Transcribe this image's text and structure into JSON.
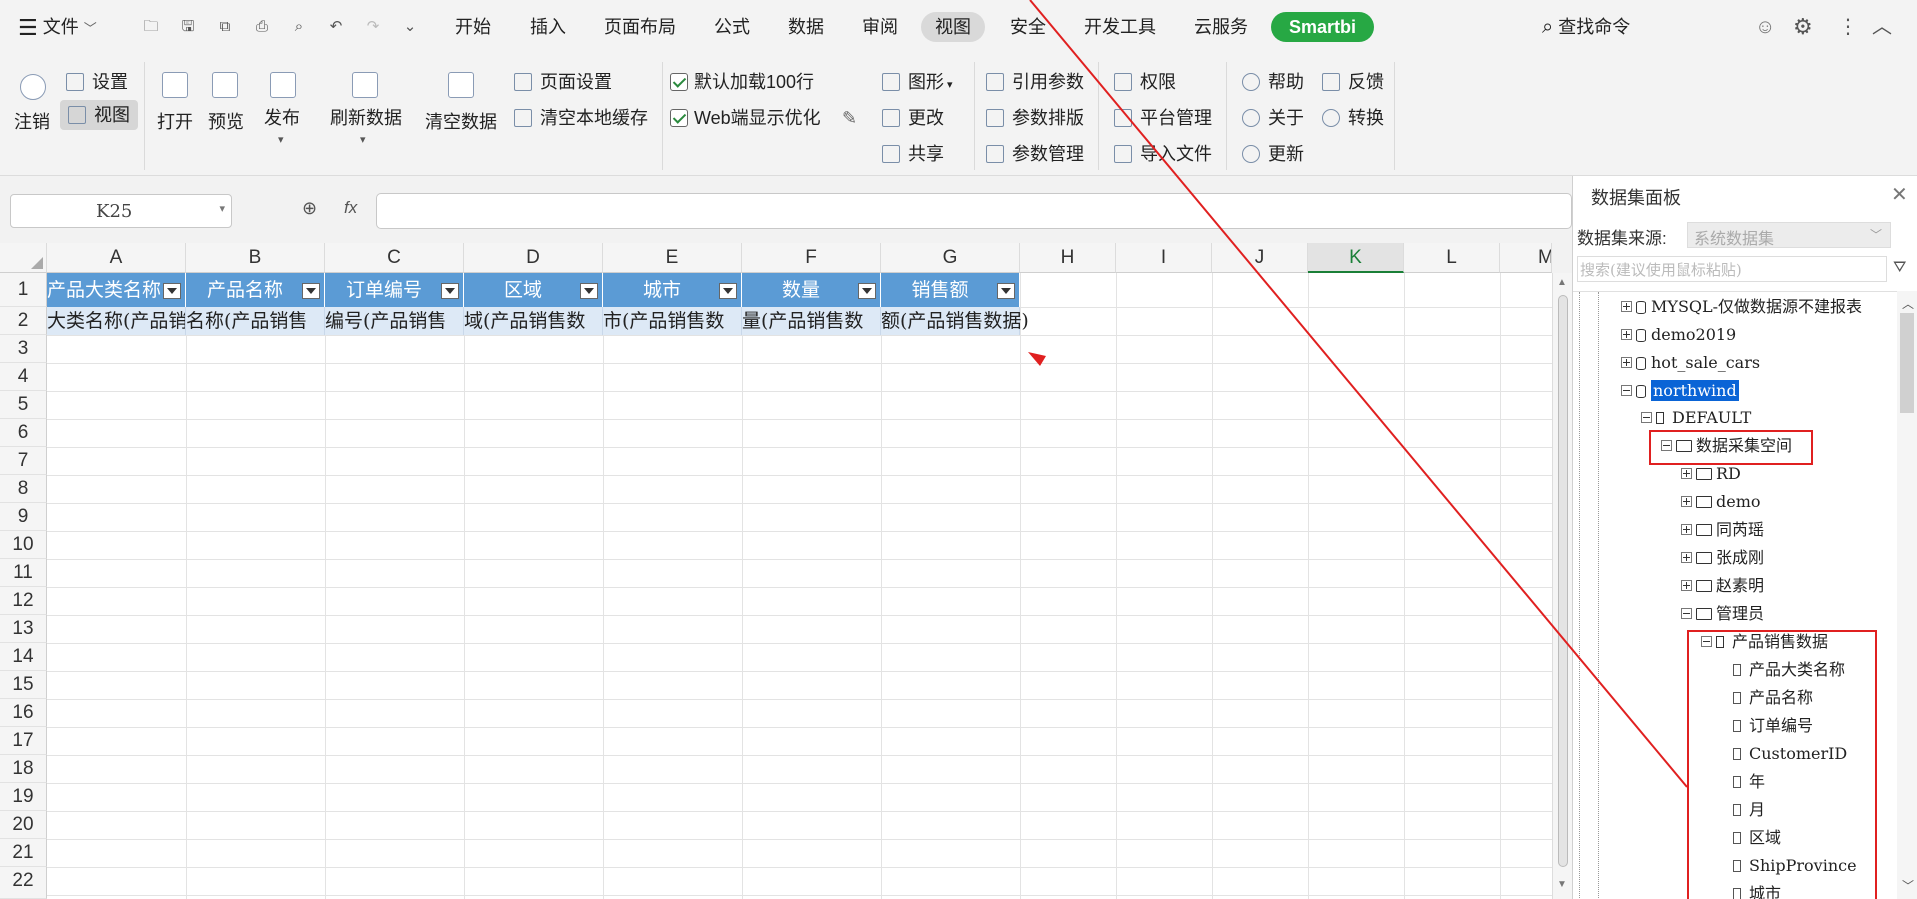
{
  "menubar": {
    "file_label": "文件",
    "tabs": [
      "开始",
      "插入",
      "页面布局",
      "公式",
      "数据",
      "审阅",
      "视图",
      "安全",
      "开发工具",
      "云服务"
    ],
    "smartbi_label": "Smartbi",
    "search_label": "查找命令"
  },
  "ribbon": {
    "logout": "注销",
    "settings": "设置",
    "view": "视图",
    "open": "打开",
    "preview": "预览",
    "publish": "发布",
    "refresh": "刷新数据",
    "clear_data": "清空数据",
    "page_setup": "页面设置",
    "clear_cache": "清空本地缓存",
    "default_load": "默认加载100行",
    "web_optimize": "Web端显示优化",
    "chart": "图形",
    "modify": "更改",
    "share": "共享",
    "ref_param": "引用参数",
    "param_layout": "参数排版",
    "param_manage": "参数管理",
    "permission": "权限",
    "platform": "平台管理",
    "import": "导入文件",
    "help": "帮助",
    "about": "关于",
    "update": "更新",
    "feedback": "反馈",
    "convert": "转换"
  },
  "formula_bar": {
    "cell_ref": "K25",
    "fx": "fx",
    "value": ""
  },
  "sheet": {
    "columns": [
      "A",
      "B",
      "C",
      "D",
      "E",
      "F",
      "G",
      "H",
      "I",
      "J",
      "K",
      "L",
      "M"
    ],
    "active_column": "K",
    "rows": [
      "1",
      "2",
      "3",
      "4",
      "5",
      "6",
      "7",
      "8",
      "9",
      "10",
      "11",
      "12",
      "13",
      "14",
      "15",
      "16",
      "17",
      "18",
      "19",
      "20",
      "21",
      "22"
    ],
    "header_cells": [
      "产品大类名称",
      "产品名称",
      "订单编号",
      "区域",
      "城市",
      "数量",
      "销售额"
    ],
    "data_cells": [
      "大类名称(产品销",
      "名称(产品销售",
      "编号(产品销售",
      "域(产品销售数",
      "市(产品销售数",
      "量(产品销售数",
      "额(产品销售数据)"
    ]
  },
  "panel": {
    "title": "数据集面板",
    "source_label": "数据集来源:",
    "source_value": "系统数据集",
    "search_placeholder": "搜索(建议使用鼠标粘贴)",
    "tree": [
      {
        "label": "MYSQL-仅做数据源不建报表",
        "type": "db",
        "toggle": "plus"
      },
      {
        "label": "demo2019",
        "type": "db",
        "toggle": "plus"
      },
      {
        "label": "hot_sale_cars",
        "type": "db",
        "toggle": "plus"
      },
      {
        "label": "northwind",
        "type": "db",
        "toggle": "minus",
        "selected": true
      },
      {
        "label": "DEFAULT",
        "type": "schema",
        "toggle": "minus"
      },
      {
        "label": "数据采集空间",
        "type": "folder",
        "toggle": "minus"
      },
      {
        "label": "RD",
        "type": "folder",
        "toggle": "plus"
      },
      {
        "label": "demo",
        "type": "folder",
        "toggle": "plus"
      },
      {
        "label": "同芮瑶",
        "type": "folder",
        "toggle": "plus"
      },
      {
        "label": "张成刚",
        "type": "folder",
        "toggle": "plus"
      },
      {
        "label": "赵素明",
        "type": "folder",
        "toggle": "plus"
      },
      {
        "label": "管理员",
        "type": "folder",
        "toggle": "minus"
      },
      {
        "label": "产品销售数据",
        "type": "dataset",
        "toggle": "minus"
      },
      {
        "label": "产品大类名称",
        "type": "field"
      },
      {
        "label": "产品名称",
        "type": "field"
      },
      {
        "label": "订单编号",
        "type": "field"
      },
      {
        "label": "CustomerID",
        "type": "field"
      },
      {
        "label": "年",
        "type": "field"
      },
      {
        "label": "月",
        "type": "field"
      },
      {
        "label": "区域",
        "type": "field"
      },
      {
        "label": "ShipProvince",
        "type": "field"
      },
      {
        "label": "城市",
        "type": "field"
      }
    ]
  },
  "colors": {
    "header_blue": "#5b9bd5",
    "data_row": "#dde9f6",
    "annotation_red": "#e02020",
    "smartbi_green": "#27a844",
    "selected_node": "#0a64d6"
  }
}
